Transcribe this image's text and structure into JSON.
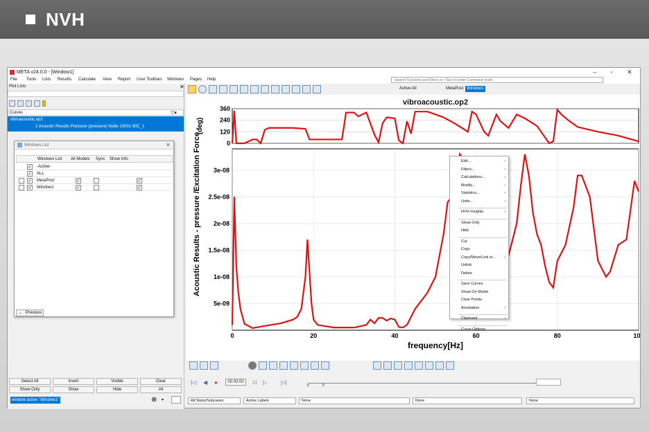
{
  "banner": {
    "title": "NVH"
  },
  "window": {
    "title": "META v24.0.0 - [Window1]"
  },
  "menu": [
    "File",
    "Tools",
    "Lists",
    "Results",
    "Calculate",
    "View",
    "Report",
    "User Toolbars",
    "Windows",
    "Pages",
    "Help"
  ],
  "search": {
    "placeholder": "Search Functions and Filters or <Tab> to enter Command mode"
  },
  "left": {
    "plot_lists_label": "Plot Lists",
    "curves_label": "Curves",
    "tree_root": "vibroacoustic.op2",
    "tree_child": "1 Acoustic Results Pressure (pressure) Node 10001 90C_1"
  },
  "windows_list": {
    "title": "Windows List",
    "headers": [
      "Windows List",
      "All Models",
      "Sync",
      "Show Info"
    ],
    "rows": [
      {
        "label": "-Active-",
        "checked": true
      },
      {
        "label": "ALL",
        "checked": true
      },
      {
        "label": "MetaPost",
        "checked": true
      },
      {
        "label": "Window1",
        "checked": true
      }
    ],
    "previous_label": "Previous"
  },
  "bottom_buttons": [
    [
      "Select All",
      "Invert",
      "Visible",
      "Clear"
    ],
    [
      "Show Only",
      "Show",
      "Hide",
      "All"
    ]
  ],
  "command_line": "window active \"Window1\"",
  "plot_toolbar": {
    "active_label": "Active:All",
    "meta_post": "MetaPost",
    "window_tag": "Window1"
  },
  "context_menu": {
    "groups": [
      [
        {
          "label": "Edit...",
          "sub": true
        },
        {
          "label": "Filters...",
          "sub": true
        },
        {
          "label": "Calculations...",
          "sub": true
        },
        {
          "label": "Modify...",
          "sub": true
        },
        {
          "label": "Statistics...",
          "sub": true
        },
        {
          "label": "Units...",
          "sub": true
        }
      ],
      [
        {
          "label": "NVH Insights",
          "sub": true
        }
      ],
      [
        {
          "label": "Show Only",
          "sub": false
        },
        {
          "label": "Hide",
          "sub": false
        }
      ],
      [
        {
          "label": "Cut",
          "sub": false
        },
        {
          "label": "Copy",
          "sub": false
        },
        {
          "label": "Copy/Move/Link to...",
          "sub": true
        },
        {
          "label": "Unlink",
          "sub": false
        },
        {
          "label": "Delete",
          "sub": false
        }
      ],
      [
        {
          "label": "Save Curves",
          "sub": false
        },
        {
          "label": "Show On Model",
          "sub": false
        },
        {
          "label": "Clear Points",
          "sub": false
        },
        {
          "label": "Annotation",
          "sub": true
        }
      ],
      [
        {
          "label": "Clipboard",
          "sub": true
        }
      ],
      [
        {
          "label": "Curve Options",
          "sub": false
        }
      ]
    ]
  },
  "timeline": {
    "time": "00:00:00",
    "tick0": "0",
    "tick1": "0"
  },
  "status_bar": {
    "steps": "All Steps/Subcases",
    "labels": "Active Labels",
    "f1": "None",
    "f2": "None",
    "f3": "None"
  },
  "chart_data": [
    {
      "type": "line",
      "title": "vibroacoustic.op2",
      "ylabel": "(deg)",
      "ylim": [
        0,
        360
      ],
      "yticks": [
        "360",
        "240",
        "120",
        "0"
      ],
      "x": [
        0,
        0.5,
        1,
        2,
        3,
        5,
        6,
        7,
        8,
        9,
        10,
        15,
        18,
        19,
        20,
        25,
        27,
        28,
        30,
        31,
        33,
        35,
        36,
        37,
        38,
        40,
        41,
        42,
        43,
        44,
        45,
        47,
        48,
        50,
        52,
        55,
        58,
        59,
        60,
        62,
        63,
        65,
        66,
        68,
        70,
        72,
        75,
        78,
        79,
        80,
        81,
        83,
        85,
        88,
        90,
        95,
        100
      ],
      "values": [
        0,
        340,
        0,
        0,
        0,
        40,
        40,
        0,
        140,
        160,
        160,
        160,
        150,
        40,
        40,
        40,
        40,
        320,
        320,
        280,
        320,
        90,
        10,
        210,
        270,
        260,
        30,
        0,
        230,
        100,
        330,
        330,
        330,
        300,
        270,
        200,
        120,
        330,
        300,
        120,
        80,
        300,
        230,
        160,
        300,
        260,
        180,
        0,
        20,
        350,
        300,
        230,
        170,
        140,
        120,
        80,
        20
      ]
    },
    {
      "type": "line",
      "xlabel": "frequency[Hz]",
      "ylabel": "Acoustic Results - pressure /Excitation Force -",
      "xlim": [
        0,
        100
      ],
      "ylim": [
        0,
        3.4e-08
      ],
      "xticks": [
        "0",
        "20",
        "40",
        "60",
        "80",
        "100"
      ],
      "yticks": [
        "5e-09",
        "1e-08",
        "1.5e-08",
        "2e-08",
        "2.5e-08",
        "3e-08"
      ],
      "x": [
        0,
        0.5,
        1,
        1.5,
        2,
        3,
        5,
        8,
        12,
        15,
        16,
        17,
        18,
        18.5,
        19,
        19.5,
        20,
        21,
        25,
        30,
        33,
        34,
        35,
        36,
        37,
        38,
        39,
        40,
        41,
        42,
        43,
        44,
        45,
        48,
        50,
        52,
        53,
        54,
        55,
        56,
        58,
        60,
        62,
        65,
        68,
        70,
        71,
        72,
        73,
        74,
        75,
        76,
        77,
        78,
        79,
        80,
        82,
        84,
        85,
        86,
        88,
        90,
        92,
        93,
        95,
        97,
        99,
        100
      ],
      "values": [
        1e-09,
        2.5e-08,
        1.2e-08,
        7e-09,
        4e-09,
        1.2e-09,
        4e-10,
        8e-10,
        1.3e-09,
        2e-09,
        2.5e-09,
        4e-09,
        1e-08,
        1.7e-08,
        1.1e-08,
        5e-09,
        2e-09,
        1e-09,
        5e-10,
        5e-10,
        1e-09,
        2e-09,
        1.3e-09,
        2.3e-09,
        2.3e-09,
        1.8e-09,
        2.2e-09,
        2e-09,
        6e-10,
        5e-10,
        1e-09,
        2.5e-09,
        4e-09,
        7e-09,
        1e-08,
        1.8e-08,
        2.4e-08,
        2.5e-08,
        2.4e-08,
        3.3e-08,
        3.1e-08,
        2e-08,
        1.4e-08,
        1.3e-08,
        1.4e-08,
        2e-08,
        2.7e-08,
        3.3e-08,
        2.9e-08,
        2.2e-08,
        1.8e-08,
        1.6e-08,
        1.2e-08,
        9e-09,
        8e-09,
        1.3e-08,
        1.6e-08,
        2.3e-08,
        2.9e-08,
        2.9e-08,
        2.5e-08,
        1.3e-08,
        1e-08,
        1.1e-08,
        1.6e-08,
        1.7e-08,
        2.8e-08,
        2.6e-08
      ]
    }
  ]
}
